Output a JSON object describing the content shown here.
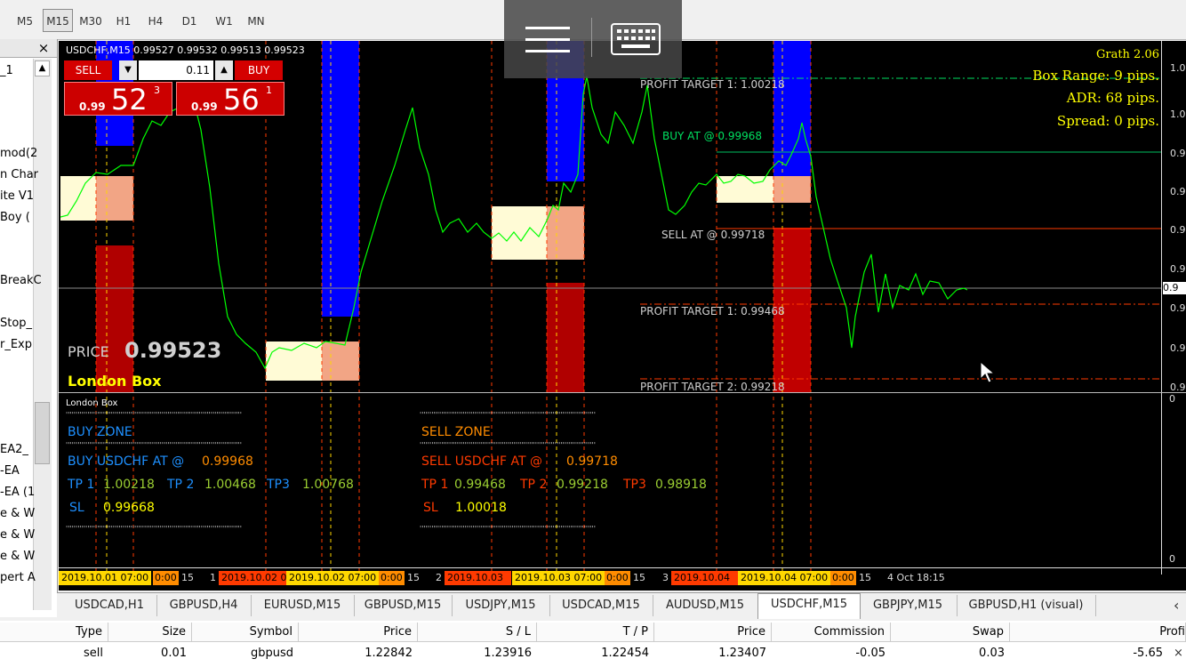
{
  "timeframes": [
    {
      "label": "M5",
      "active": false
    },
    {
      "label": "M15",
      "active": true
    },
    {
      "label": "M30",
      "active": false
    },
    {
      "label": "H1",
      "active": false
    },
    {
      "label": "H4",
      "active": false
    },
    {
      "label": "D1",
      "active": false
    },
    {
      "label": "W1",
      "active": false
    },
    {
      "label": "MN",
      "active": false
    }
  ],
  "navigator": {
    "close_label": "×",
    "items": [
      "_1",
      "mod(2",
      "n Char",
      "ite V1",
      "Boy (",
      "BreakC",
      "Stop_",
      "r_Exp",
      "EA2_",
      "-EA",
      "-EA (1",
      "e & W",
      "e & W",
      "e & W",
      "pert A"
    ]
  },
  "chart": {
    "symbol_header": "USDCHF,M15  0.99527 0.99532 0.99513 0.99523",
    "trade_panel": {
      "sell_label": "SELL",
      "buy_label": "BUY",
      "lot_value": "0.11",
      "sell_small": "0.99",
      "sell_big": "52",
      "sell_sup": "3",
      "buy_small": "0.99",
      "buy_big": "56",
      "buy_sup": "1"
    },
    "info": {
      "indicator": "Grath 2.06",
      "box_range": "Box Range: 9 pips.",
      "adr": "ADR: 68 pips.",
      "spread": "Spread: 0 pips."
    },
    "levels": {
      "pt1_up": "PROFIT TARGET 1: 1.00218",
      "buy_at": "BUY AT @ 0.99968",
      "sell_at": "SELL AT @ 0.99718",
      "pt1_down": "PROFIT TARGET 1: 0.99468",
      "pt2_down": "PROFIT TARGET 2: 0.99218"
    },
    "price_label": "PRICE",
    "price_value": "0.99523",
    "london_box": "London Box",
    "price_axis": [
      "1.0",
      "1.0",
      "0.9",
      "0.9",
      "0.9",
      "0.9",
      "0.9",
      "0.9",
      "0.9",
      "0.9"
    ],
    "current_price_tag": "0.9",
    "sub_window": {
      "title": "London Box",
      "axis_top": "0",
      "axis_bottom": "0",
      "dots": "''''''''''''''''''''''''''''''''''''''''''''''''''''''''''''''''''''''''''''''''''''''''''",
      "buy_zone": "BUY ZONE",
      "buy_line_label": "BUY USDCHF AT @",
      "buy_line_value": "0.99968",
      "buy_tp1_label": "TP 1",
      "buy_tp1": "1.00218",
      "buy_tp2_label": "TP 2",
      "buy_tp2": "1.00468",
      "buy_tp3_label": "TP3",
      "buy_tp3": "1.00768",
      "buy_sl_label": "SL",
      "buy_sl": "0.99668",
      "sell_zone": "SELL ZONE",
      "sell_line_label": "SELL USDCHF AT @",
      "sell_line_value": "0.99718",
      "sell_tp1_label": "TP 1",
      "sell_tp1": "0.99468",
      "sell_tp2_label": "TP 2",
      "sell_tp2": "0.99218",
      "sell_tp3_label": "TP3",
      "sell_tp3": "0.98918",
      "sell_sl_label": "SL",
      "sell_sl": "1.00018"
    },
    "time_axis": [
      {
        "text": "2019.10.01 07:00",
        "style": "yellow"
      },
      {
        "text": "0:00",
        "style": "orange"
      },
      {
        "text": "15",
        "style": "plain"
      },
      {
        "text": "1",
        "style": "plain"
      },
      {
        "text": "2019.10.02 0",
        "style": "red"
      },
      {
        "text": "2019.10.02 07:00",
        "style": "yellow"
      },
      {
        "text": "0:00",
        "style": "orange"
      },
      {
        "text": "15",
        "style": "plain"
      },
      {
        "text": "2",
        "style": "plain"
      },
      {
        "text": "2019.10.03",
        "style": "red"
      },
      {
        "text": "2019.10.03 07:00",
        "style": "yellow"
      },
      {
        "text": "0:00",
        "style": "orange"
      },
      {
        "text": "15",
        "style": "plain"
      },
      {
        "text": "3",
        "style": "plain"
      },
      {
        "text": "2019.10.04",
        "style": "red"
      },
      {
        "text": "2019.10.04 07:00",
        "style": "yellow"
      },
      {
        "text": "0:00",
        "style": "orange"
      },
      {
        "text": "15",
        "style": "plain"
      },
      {
        "text": "4 Oct 18:15",
        "style": "plain"
      }
    ]
  },
  "tabs": [
    {
      "label": "USDCAD,H1",
      "active": false
    },
    {
      "label": "GBPUSD,H4",
      "active": false
    },
    {
      "label": "EURUSD,M15",
      "active": false
    },
    {
      "label": "GBPUSD,M15",
      "active": false
    },
    {
      "label": "USDJPY,M15",
      "active": false
    },
    {
      "label": "USDCAD,M15",
      "active": false
    },
    {
      "label": "AUDUSD,M15",
      "active": false
    },
    {
      "label": "USDCHF,M15",
      "active": true
    },
    {
      "label": "GBPJPY,M15",
      "active": false
    },
    {
      "label": "GBPUSD,H1 (visual)",
      "active": false
    }
  ],
  "tab_scroll_icon": "‹",
  "trade_table": {
    "headers": [
      "Type",
      "Size",
      "Symbol",
      "Price",
      "S / L",
      "T / P",
      "Price",
      "Commission",
      "Swap",
      "Profi"
    ],
    "row": [
      "sell",
      "0.01",
      "gbpusd",
      "1.22842",
      "1.23916",
      "1.22454",
      "1.23407",
      "-0.05",
      "0.03",
      "-5.65"
    ],
    "close_icon": "×"
  },
  "colors": {
    "chart_bg": "#000000",
    "price_line": "#00ff00",
    "sell_button": "#cc0000",
    "zone_light": "#fffbd6",
    "zone_salmon": "#f2a585",
    "zone_blue": "#0000ff",
    "zone_red": "#cc0000",
    "buy_text": "#1e90ff",
    "sell_text": "#ff8c00",
    "value_yellow": "#ffff00",
    "value_green": "#9acd32"
  }
}
